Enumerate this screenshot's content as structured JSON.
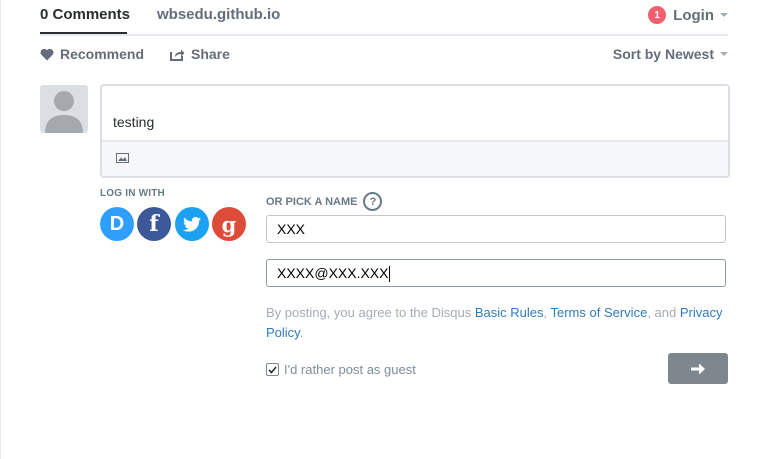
{
  "nav": {
    "comments_tab": "0 Comments",
    "site_tab": "wbsedu.github.io",
    "login_badge": "1",
    "login_label": "Login"
  },
  "subbar": {
    "recommend_label": "Recommend",
    "share_label": "Share",
    "sort_label": "Sort by Newest"
  },
  "compose": {
    "text": "testing"
  },
  "guest_login": {
    "login_with_label": "LOG IN WITH",
    "social": [
      {
        "name": "Disqus",
        "glyph": "D",
        "color": "#2e9fff"
      },
      {
        "name": "Facebook",
        "glyph": "f",
        "color": "#3b5998"
      },
      {
        "name": "Twitter",
        "glyph": "twitter-bird-icon",
        "color": "#1da1f2"
      },
      {
        "name": "Google",
        "glyph": "g",
        "color": "#dd4b39"
      }
    ],
    "pick_name_label": "OR PICK A NAME",
    "help_glyph": "?",
    "name_value": "XXX",
    "email_value": "XXXX@XXX.XXX"
  },
  "terms": {
    "prefix": "By posting, you agree to the Disqus ",
    "basic_rules": "Basic Rules",
    "sep1": ", ",
    "terms_of_service": "Terms of Service",
    "sep2": ", and ",
    "privacy_policy": "Privacy Policy",
    "suffix": "."
  },
  "guest_checkbox": {
    "label": "I'd rather post as guest",
    "checked": true
  },
  "colors": {
    "accent": "#2e7bc1",
    "badge": "#f05f70",
    "submit": "#7e878e"
  }
}
